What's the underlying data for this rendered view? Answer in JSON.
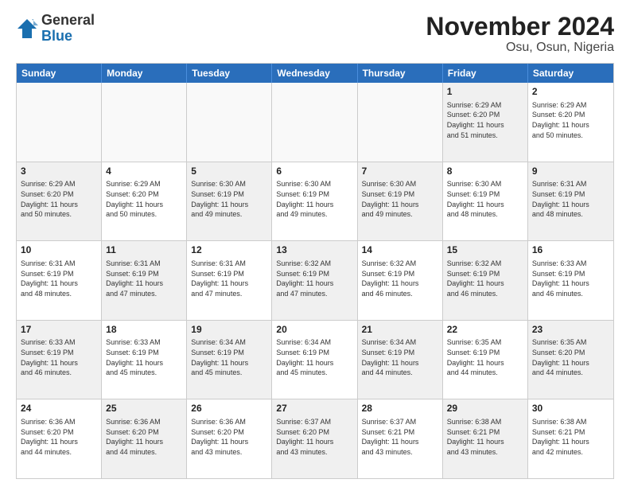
{
  "header": {
    "logo": {
      "general": "General",
      "blue": "Blue"
    },
    "title": "November 2024",
    "subtitle": "Osu, Osun, Nigeria"
  },
  "calendar": {
    "days_of_week": [
      "Sunday",
      "Monday",
      "Tuesday",
      "Wednesday",
      "Thursday",
      "Friday",
      "Saturday"
    ],
    "rows": [
      [
        {
          "day": "",
          "info": "",
          "empty": true
        },
        {
          "day": "",
          "info": "",
          "empty": true
        },
        {
          "day": "",
          "info": "",
          "empty": true
        },
        {
          "day": "",
          "info": "",
          "empty": true
        },
        {
          "day": "",
          "info": "",
          "empty": true
        },
        {
          "day": "1",
          "info": "Sunrise: 6:29 AM\nSunset: 6:20 PM\nDaylight: 11 hours\nand 51 minutes.",
          "shaded": true
        },
        {
          "day": "2",
          "info": "Sunrise: 6:29 AM\nSunset: 6:20 PM\nDaylight: 11 hours\nand 50 minutes.",
          "shaded": false
        }
      ],
      [
        {
          "day": "3",
          "info": "Sunrise: 6:29 AM\nSunset: 6:20 PM\nDaylight: 11 hours\nand 50 minutes.",
          "shaded": true
        },
        {
          "day": "4",
          "info": "Sunrise: 6:29 AM\nSunset: 6:20 PM\nDaylight: 11 hours\nand 50 minutes.",
          "shaded": false
        },
        {
          "day": "5",
          "info": "Sunrise: 6:30 AM\nSunset: 6:19 PM\nDaylight: 11 hours\nand 49 minutes.",
          "shaded": true
        },
        {
          "day": "6",
          "info": "Sunrise: 6:30 AM\nSunset: 6:19 PM\nDaylight: 11 hours\nand 49 minutes.",
          "shaded": false
        },
        {
          "day": "7",
          "info": "Sunrise: 6:30 AM\nSunset: 6:19 PM\nDaylight: 11 hours\nand 49 minutes.",
          "shaded": true
        },
        {
          "day": "8",
          "info": "Sunrise: 6:30 AM\nSunset: 6:19 PM\nDaylight: 11 hours\nand 48 minutes.",
          "shaded": false
        },
        {
          "day": "9",
          "info": "Sunrise: 6:31 AM\nSunset: 6:19 PM\nDaylight: 11 hours\nand 48 minutes.",
          "shaded": true
        }
      ],
      [
        {
          "day": "10",
          "info": "Sunrise: 6:31 AM\nSunset: 6:19 PM\nDaylight: 11 hours\nand 48 minutes.",
          "shaded": false
        },
        {
          "day": "11",
          "info": "Sunrise: 6:31 AM\nSunset: 6:19 PM\nDaylight: 11 hours\nand 47 minutes.",
          "shaded": true
        },
        {
          "day": "12",
          "info": "Sunrise: 6:31 AM\nSunset: 6:19 PM\nDaylight: 11 hours\nand 47 minutes.",
          "shaded": false
        },
        {
          "day": "13",
          "info": "Sunrise: 6:32 AM\nSunset: 6:19 PM\nDaylight: 11 hours\nand 47 minutes.",
          "shaded": true
        },
        {
          "day": "14",
          "info": "Sunrise: 6:32 AM\nSunset: 6:19 PM\nDaylight: 11 hours\nand 46 minutes.",
          "shaded": false
        },
        {
          "day": "15",
          "info": "Sunrise: 6:32 AM\nSunset: 6:19 PM\nDaylight: 11 hours\nand 46 minutes.",
          "shaded": true
        },
        {
          "day": "16",
          "info": "Sunrise: 6:33 AM\nSunset: 6:19 PM\nDaylight: 11 hours\nand 46 minutes.",
          "shaded": false
        }
      ],
      [
        {
          "day": "17",
          "info": "Sunrise: 6:33 AM\nSunset: 6:19 PM\nDaylight: 11 hours\nand 46 minutes.",
          "shaded": true
        },
        {
          "day": "18",
          "info": "Sunrise: 6:33 AM\nSunset: 6:19 PM\nDaylight: 11 hours\nand 45 minutes.",
          "shaded": false
        },
        {
          "day": "19",
          "info": "Sunrise: 6:34 AM\nSunset: 6:19 PM\nDaylight: 11 hours\nand 45 minutes.",
          "shaded": true
        },
        {
          "day": "20",
          "info": "Sunrise: 6:34 AM\nSunset: 6:19 PM\nDaylight: 11 hours\nand 45 minutes.",
          "shaded": false
        },
        {
          "day": "21",
          "info": "Sunrise: 6:34 AM\nSunset: 6:19 PM\nDaylight: 11 hours\nand 44 minutes.",
          "shaded": true
        },
        {
          "day": "22",
          "info": "Sunrise: 6:35 AM\nSunset: 6:19 PM\nDaylight: 11 hours\nand 44 minutes.",
          "shaded": false
        },
        {
          "day": "23",
          "info": "Sunrise: 6:35 AM\nSunset: 6:20 PM\nDaylight: 11 hours\nand 44 minutes.",
          "shaded": true
        }
      ],
      [
        {
          "day": "24",
          "info": "Sunrise: 6:36 AM\nSunset: 6:20 PM\nDaylight: 11 hours\nand 44 minutes.",
          "shaded": false
        },
        {
          "day": "25",
          "info": "Sunrise: 6:36 AM\nSunset: 6:20 PM\nDaylight: 11 hours\nand 44 minutes.",
          "shaded": true
        },
        {
          "day": "26",
          "info": "Sunrise: 6:36 AM\nSunset: 6:20 PM\nDaylight: 11 hours\nand 43 minutes.",
          "shaded": false
        },
        {
          "day": "27",
          "info": "Sunrise: 6:37 AM\nSunset: 6:20 PM\nDaylight: 11 hours\nand 43 minutes.",
          "shaded": true
        },
        {
          "day": "28",
          "info": "Sunrise: 6:37 AM\nSunset: 6:21 PM\nDaylight: 11 hours\nand 43 minutes.",
          "shaded": false
        },
        {
          "day": "29",
          "info": "Sunrise: 6:38 AM\nSunset: 6:21 PM\nDaylight: 11 hours\nand 43 minutes.",
          "shaded": true
        },
        {
          "day": "30",
          "info": "Sunrise: 6:38 AM\nSunset: 6:21 PM\nDaylight: 11 hours\nand 42 minutes.",
          "shaded": false
        }
      ]
    ]
  }
}
